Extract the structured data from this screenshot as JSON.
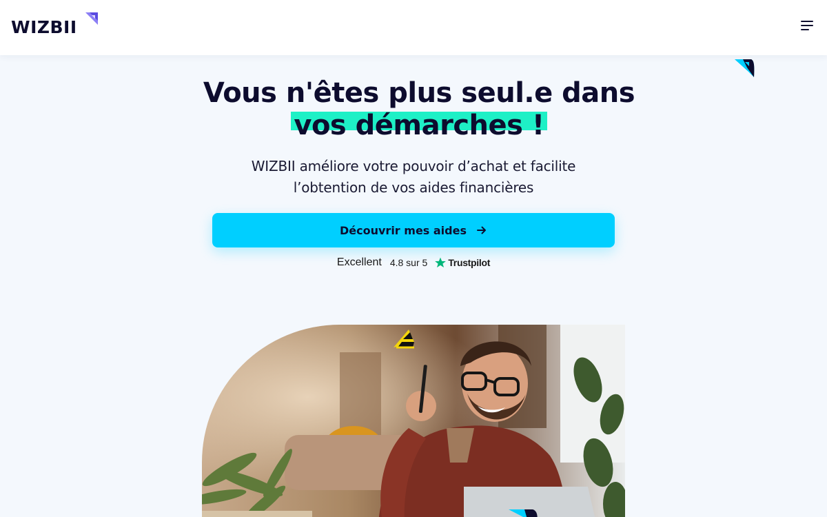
{
  "header": {
    "logo_text": "WIZBII",
    "menu_icon": "hamburger-menu-icon"
  },
  "hero": {
    "title_line1": "Vous n'êtes plus seul.e dans",
    "title_highlight": "vos démarches !",
    "subtitle_line1": "WIZBII améliore votre pouvoir d’achat et facilite",
    "subtitle_line2": "l’obtention de vos aides financières",
    "cta_label": "Découvrir mes aides",
    "cta_icon": "arrow-right-icon"
  },
  "trustpilot": {
    "rating_word": "Excellent",
    "score_text": "4.8 sur 5",
    "brand": "Trustpilot",
    "icon": "star-icon"
  },
  "colors": {
    "navy": "#0d0c2e",
    "cta": "#00cfff",
    "highlight": "#1ef0c6",
    "logo_accent": "#7b6cf0",
    "trust_green": "#00b67a"
  },
  "photo": {
    "description_icon": "hero-photo"
  }
}
